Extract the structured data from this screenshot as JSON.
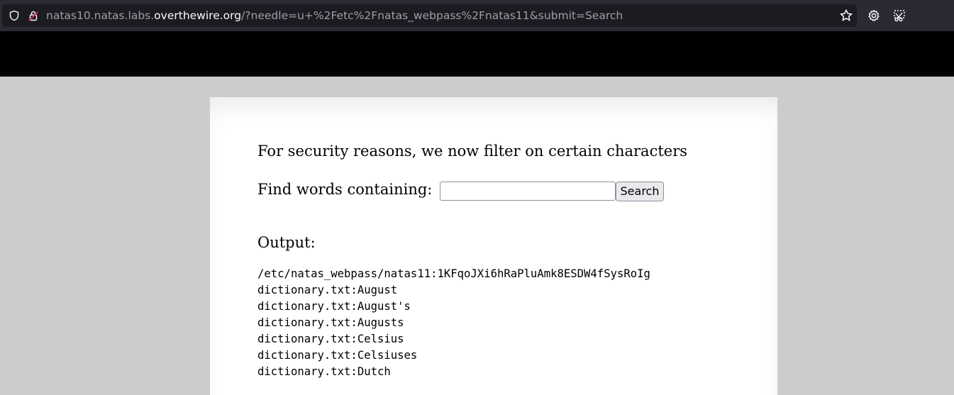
{
  "browser": {
    "url_prefix": "natas10.natas.labs.",
    "url_host": "overthewire.org",
    "url_rest": "/?needle=u+%2Fetc%2Fnatas_webpass%2Fnatas11&submit=Search",
    "icons": [
      "shield-icon",
      "insecure-lock-icon",
      "bookmark-star-icon",
      "settings-gear-icon",
      "screenshot-icon"
    ]
  },
  "page": {
    "heading": "For security reasons, we now filter on certain characters",
    "find_label": "Find words containing:",
    "search_input_value": "",
    "search_button": "Search",
    "output_label": "Output:",
    "output_lines": [
      "/etc/natas_webpass/natas11:1KFqoJXi6hRaPluAmk8ESDW4fSysRoIg",
      "dictionary.txt:August",
      "dictionary.txt:August's",
      "dictionary.txt:Augusts",
      "dictionary.txt:Celsius",
      "dictionary.txt:Celsiuses",
      "dictionary.txt:Dutch"
    ]
  },
  "colors": {
    "toolbar_bg": "#2b2a33",
    "urlbar_bg": "#1c1b22",
    "banner_bg": "#000000",
    "page_bg": "#cccccc",
    "card_bg": "#ffffff",
    "insecure_lock": "#e22850"
  }
}
